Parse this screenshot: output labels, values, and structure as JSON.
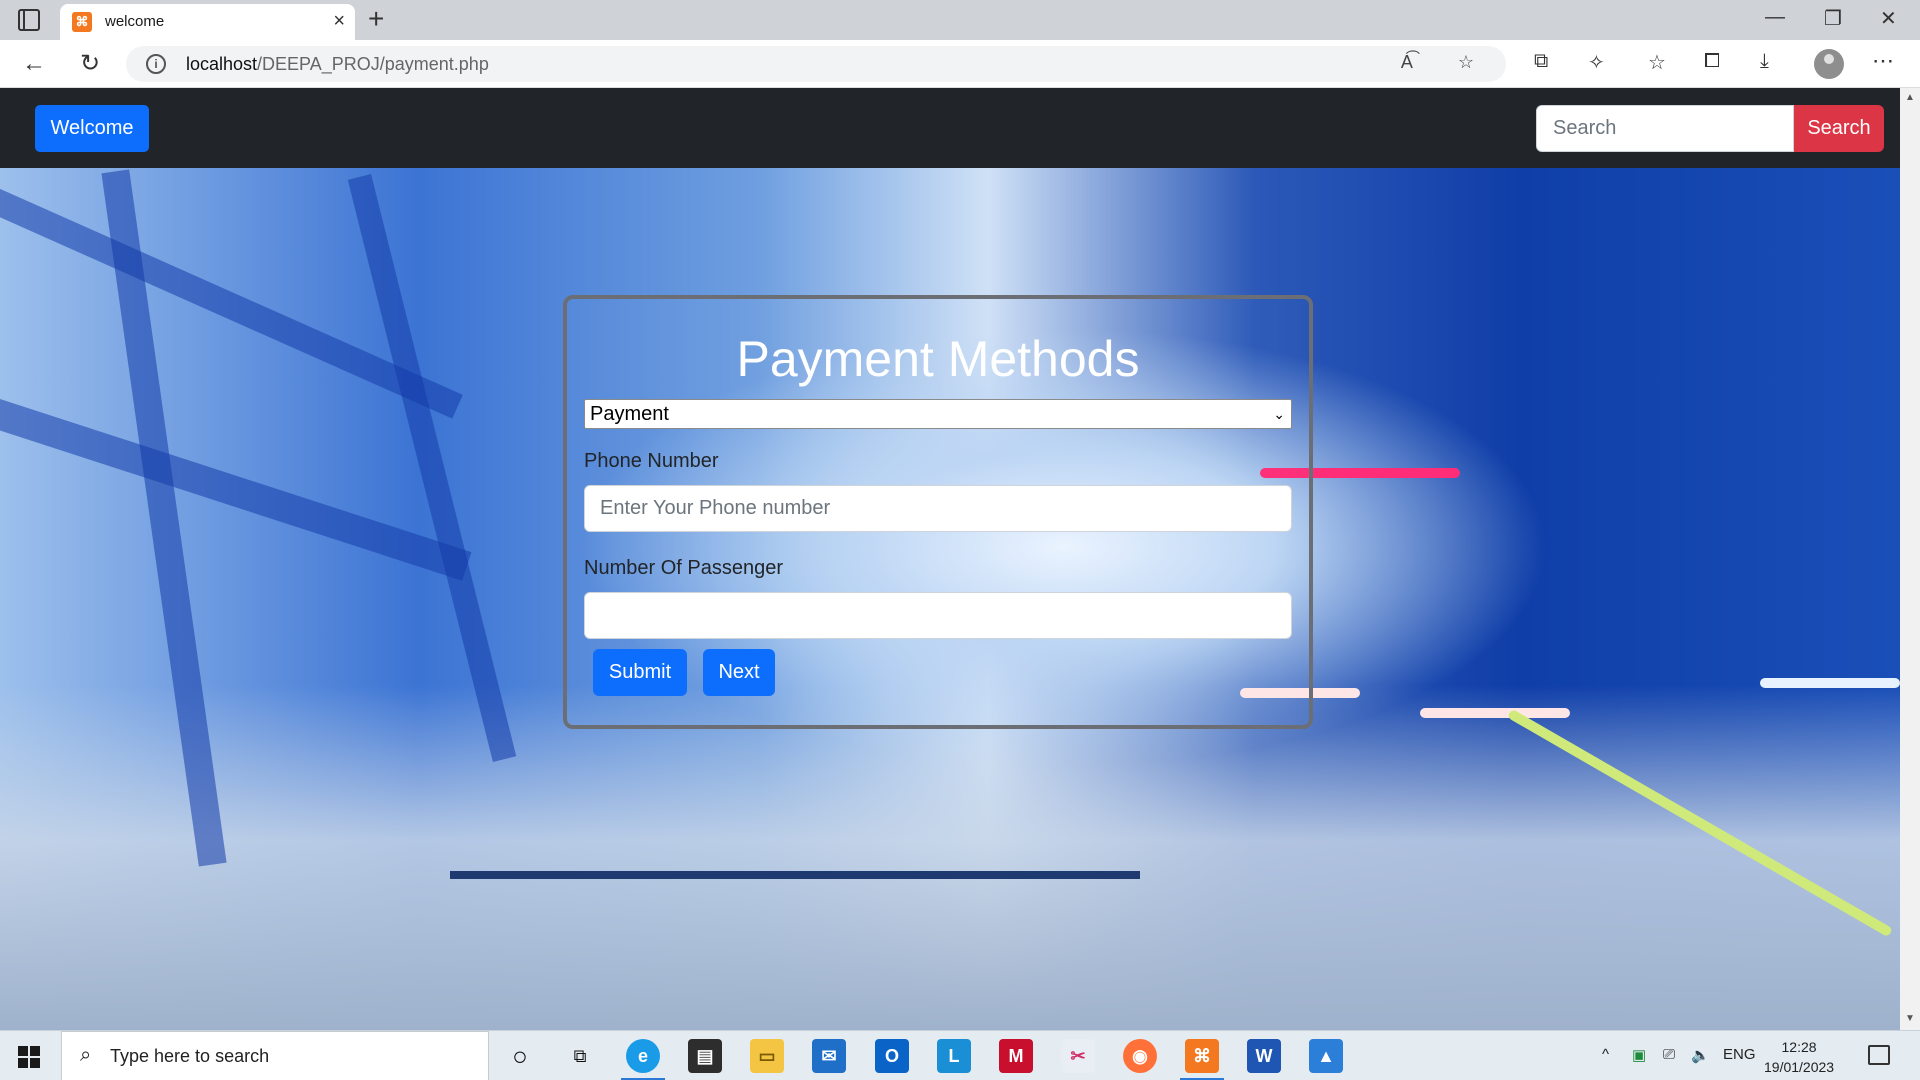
{
  "browser": {
    "tab_title": "welcome",
    "tab_favicon_text": "⌘",
    "url_host": "localhost",
    "url_path": "/DEEPA_PROJ/payment.php"
  },
  "navbar": {
    "brand_label": "Welcome",
    "search_placeholder": "Search",
    "search_button": "Search"
  },
  "form": {
    "title": "Payment Methods",
    "select_value": "Payment",
    "phone_label": "Phone Number",
    "phone_placeholder": "Enter Your Phone number",
    "passenger_label": "Number Of Passenger",
    "passenger_value": "",
    "submit_label": "Submit",
    "next_label": "Next"
  },
  "taskbar": {
    "search_placeholder": "Type here to search",
    "language": "ENG",
    "time": "12:28",
    "date": "19/01/2023",
    "apps": [
      "cortana-icon",
      "task-view-icon",
      "edge-icon",
      "store-icon",
      "file-explorer-icon",
      "mail-icon",
      "outlook-icon",
      "lexicon-icon",
      "mcafee-icon",
      "snip-icon",
      "firefox-icon",
      "xampp-icon",
      "word-icon",
      "photos-icon"
    ]
  },
  "colors": {
    "primary": "#0d6efd",
    "danger": "#dc3545",
    "navbar_bg": "#212529"
  }
}
